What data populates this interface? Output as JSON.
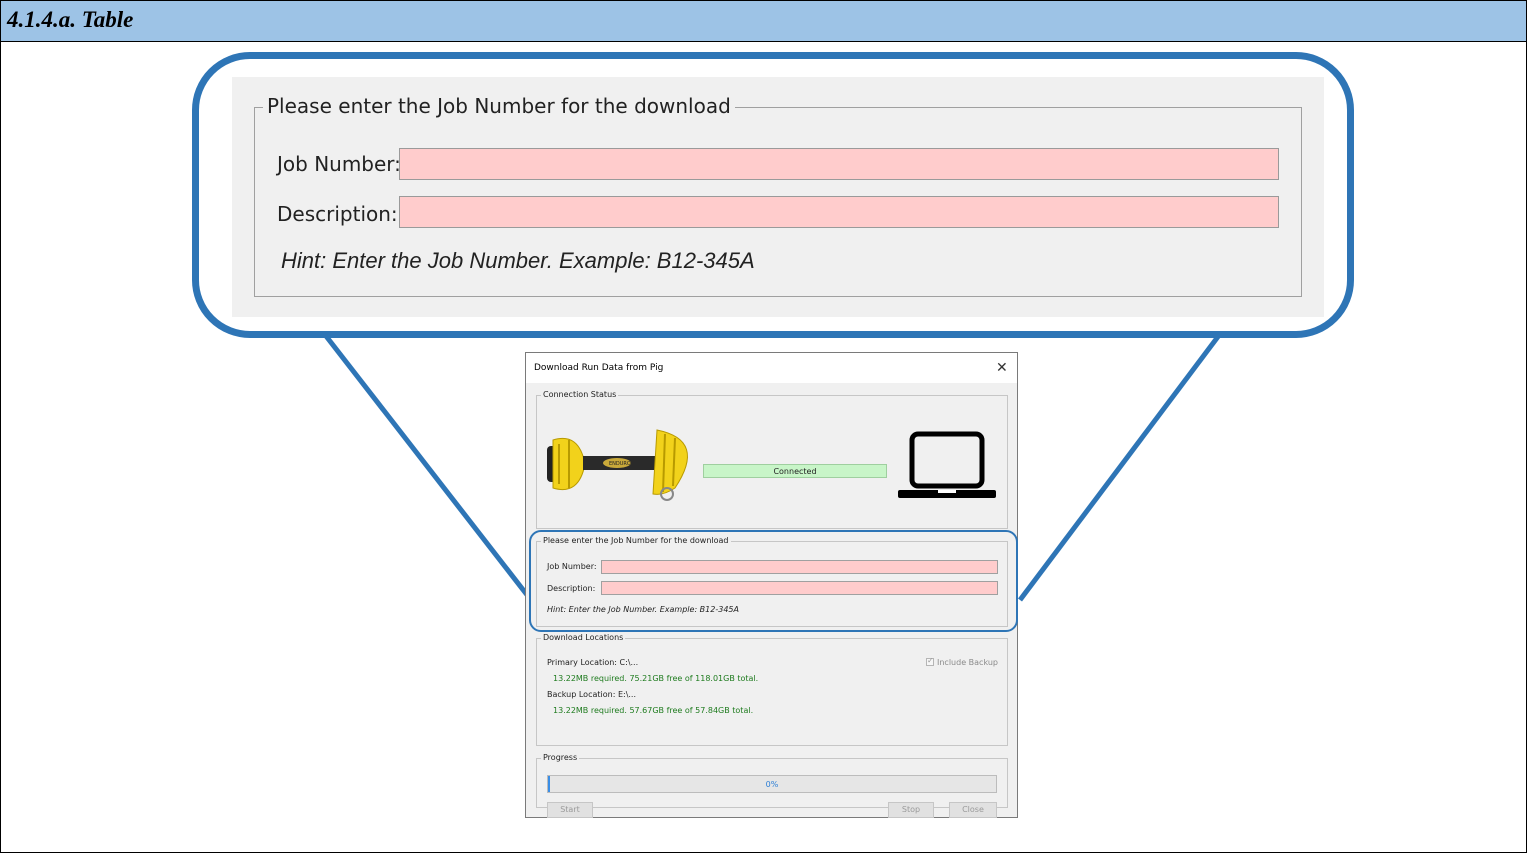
{
  "header": {
    "title": "4.1.4.a. Table"
  },
  "callout": {
    "legend": "Please enter the Job Number for the download",
    "job_label": "Job Number:",
    "desc_label": "Description:",
    "hint": "Hint:   Enter the Job Number. Example: B12-345A"
  },
  "dialog": {
    "title": "Download Run Data from Pig",
    "close_glyph": "✕",
    "connection": {
      "legend": "Connection Status",
      "status": "Connected",
      "pig_brand": "ENDURO"
    },
    "job": {
      "legend": "Please enter the Job Number for the download",
      "job_label": "Job Number:",
      "desc_label": "Description:",
      "job_value": "",
      "desc_value": "",
      "hint": "Hint:  Enter the Job Number. Example: B12-345A"
    },
    "locations": {
      "legend": "Download Locations",
      "primary_label": "Primary Location:  C:\\...",
      "primary_info": "13.22MB required. 75.21GB free of 118.01GB total.",
      "backup_label": "Backup Location:  E:\\...",
      "backup_info": "13.22MB required. 57.67GB free of 57.84GB total.",
      "include_backup": "Include Backup",
      "include_backup_checked": true
    },
    "progress": {
      "legend": "Progress",
      "value": 0,
      "text": "0%",
      "start": "Start",
      "stop": "Stop",
      "close": "Close"
    }
  },
  "colors": {
    "header_bg": "#9dc3e6",
    "callout_border": "#2e75b6",
    "input_pink": "#ffcccc",
    "status_green": "#c8f5c8",
    "info_green": "#1e7b1e",
    "progress_blue": "#3a8ee6"
  },
  "icons": [
    "pig-tool-icon",
    "laptop-icon",
    "close-icon",
    "checkbox-icon"
  ]
}
